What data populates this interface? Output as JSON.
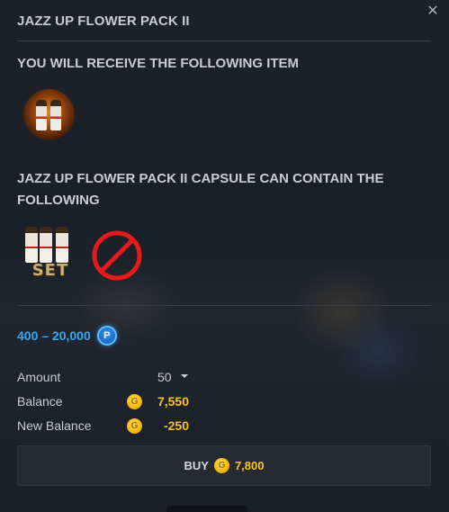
{
  "dialog": {
    "title": "JAZZ UP FLOWER PACK II",
    "close_glyph": "✕"
  },
  "receive": {
    "heading": "YOU WILL RECEIVE THE FOLLOWING ITEM",
    "item_icon": "jazz-up-flower-pack-icon"
  },
  "contents": {
    "heading": "JAZZ UP FLOWER PACK II CAPSULE CAN CONTAIN THE FOLLOWING",
    "item_icon": "costume-set-icon",
    "item_label": "SET",
    "unavailable_icon": "prohibited-icon"
  },
  "price_range": {
    "text": "400 – 20,000",
    "currency_icon": "p-coin-icon",
    "currency_glyph": "P",
    "color": "#3aa7f0"
  },
  "summary": {
    "amount_label": "Amount",
    "amount_value": "50",
    "balance_label": "Balance",
    "balance_value": "7,550",
    "new_balance_label": "New Balance",
    "new_balance_value": "-250",
    "coin_glyph": "G"
  },
  "buy": {
    "label": "BUY",
    "price": "7,800"
  },
  "colors": {
    "gold": "#f7c51a",
    "background": "#1a1e26",
    "text": "#c9ccd3"
  }
}
